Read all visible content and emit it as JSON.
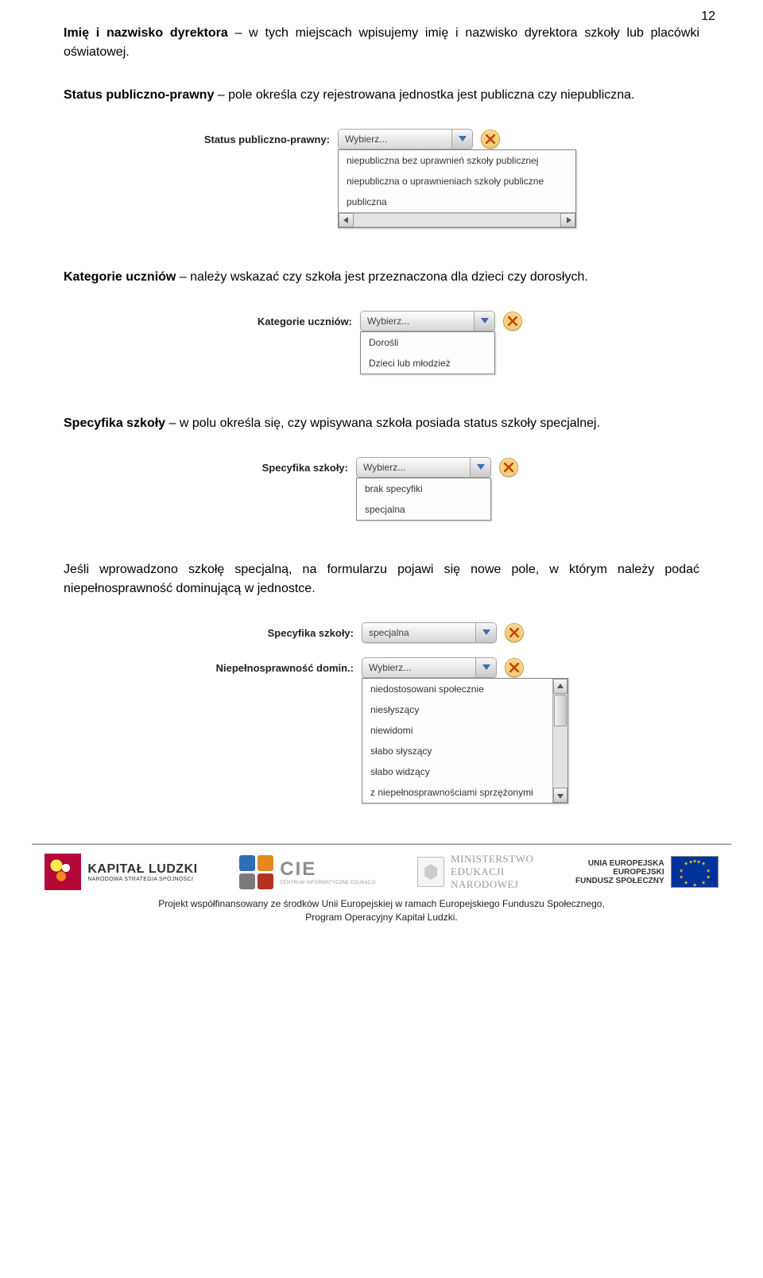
{
  "pageNumber": "12",
  "paragraphs": {
    "p1a": "Imię i nazwisko dyrektora",
    "p1b": " – w tych miejscach wpisujemy imię i nazwisko dyrektora szkoły lub placówki oświatowej.",
    "p2a": "Status publiczno-prawny",
    "p2b": " – pole określa czy rejestrowana jednostka jest publiczna czy niepubliczna.",
    "p3a": "Kategorie uczniów",
    "p3b": " – należy wskazać czy szkoła jest przeznaczona dla dzieci czy dorosłych.",
    "p4a": "Specyfika szkoły",
    "p4b": " – w polu określa się, czy wpisywana szkoła posiada status szkoły specjalnej.",
    "p5": "Jeśli wprowadzono szkołę specjalną, na formularzu pojawi się nowe pole, w którym należy podać niepełnosprawność dominującą w jednostce."
  },
  "fig1": {
    "label": "Status publiczno-prawny:",
    "combo": "Wybierz...",
    "options": [
      "niepubliczna bez uprawnień szkoły publicznej",
      "niepubliczna o uprawnieniach szkoły publiczne",
      "publiczna"
    ]
  },
  "fig2": {
    "label": "Kategorie uczniów:",
    "combo": "Wybierz...",
    "options": [
      "Dorośli",
      "Dzieci lub młodzież"
    ]
  },
  "fig3": {
    "label": "Specyfika szkoły:",
    "combo": "Wybierz...",
    "options": [
      "brak specyfiki",
      "specjalna"
    ]
  },
  "fig4": {
    "row1label": "Specyfika szkoły:",
    "row1value": "specjalna",
    "row2label": "Niepełnosprawność domin.:",
    "row2combo": "Wybierz...",
    "options": [
      "niedostosowani społecznie",
      "niesłyszący",
      "niewidomi",
      "słabo słyszący",
      "słabo widzący",
      "z niepełnosprawnościami sprzężonymi"
    ]
  },
  "footer": {
    "kapital_big": "KAPITAŁ LUDZKI",
    "kapital_small": "NARODOWA STRATEGIA SPÓJNOŚCI",
    "cie_big": "CIE",
    "cie_small": "CENTRUM INFORMATYCZNE EDUKACJI",
    "men1": "MINISTERSTWO",
    "men2": "EDUKACJI",
    "men3": "NARODOWEJ",
    "eu1": "UNIA EUROPEJSKA",
    "eu2": "EUROPEJSKI",
    "eu3": "FUNDUSZ SPOŁECZNY",
    "caption1": "Projekt współfinansowany ze środków Unii Europejskiej w ramach Europejskiego Funduszu Społecznego,",
    "caption2": "Program Operacyjny Kapitał Ludzki."
  }
}
